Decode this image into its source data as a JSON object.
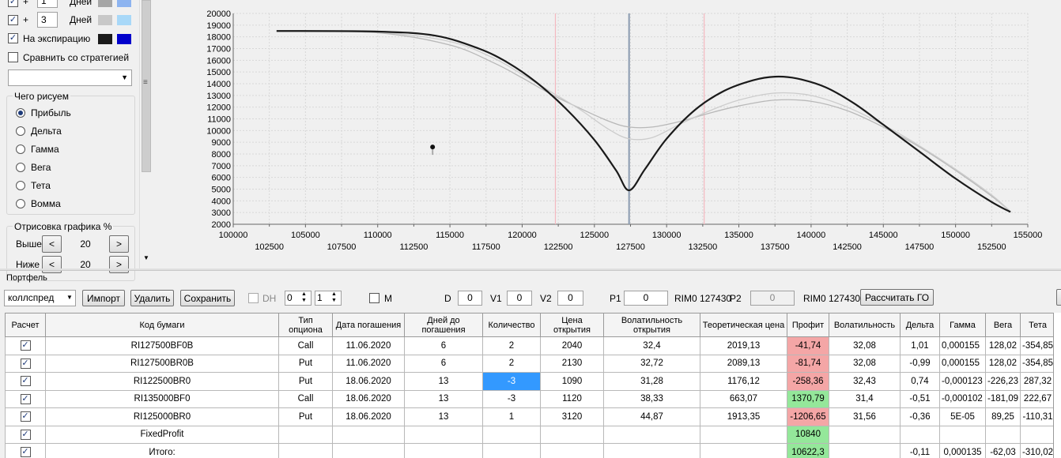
{
  "left_panel": {
    "rows": [
      {
        "sign": "+",
        "days": "1",
        "unit": "Дней",
        "color1": "#a6a6a6",
        "color2": "#8db4f0"
      },
      {
        "sign": "+",
        "days": "3",
        "unit": "Дней",
        "color1": "#c8c8c8",
        "color2": "#a8d8f8"
      }
    ],
    "expiry_label": "На экспирацию",
    "expiry_color1": "#1a1a1a",
    "expiry_color2": "#0000cc",
    "compare_label": "Сравнить со стратегией",
    "draw_group": {
      "title": "Чего рисуем",
      "options": [
        "Прибыль",
        "Дельта",
        "Гамма",
        "Вега",
        "Тета",
        "Вомма"
      ],
      "selected": "Прибыль"
    },
    "render_group": {
      "title": "Отрисовка графика %",
      "above_label": "Выше",
      "above_value": "20",
      "below_label": "Ниже",
      "below_value": "20",
      "dec": "<",
      "inc": ">"
    }
  },
  "chart_data": {
    "type": "line",
    "title": "",
    "xlabel": "",
    "ylabel": "",
    "xlim": [
      100000,
      155000
    ],
    "ylim": [
      2000,
      20000
    ],
    "x_ticks_top": [
      "100000",
      "110000",
      "115000",
      "120000",
      "125000",
      "130000",
      "135000",
      "140000",
      "145000",
      "150000",
      "155000"
    ],
    "x_ticks_upper": [
      100000,
      105000,
      110000,
      115000,
      120000,
      125000,
      130000,
      135000,
      140000,
      145000,
      150000,
      155000
    ],
    "x_ticks_lower": [
      102500,
      107500,
      112500,
      117500,
      122500,
      127500,
      132500,
      137500,
      142500,
      147500,
      152500
    ],
    "y_ticks": [
      2000,
      3000,
      4000,
      5000,
      6000,
      7000,
      8000,
      9000,
      10000,
      11000,
      12000,
      13000,
      14000,
      15000,
      16000,
      17000,
      18000,
      19000,
      20000
    ],
    "grid": true,
    "vlines": [
      {
        "x": 122300,
        "color": "#f4b8c0"
      },
      {
        "x": 127400,
        "color": "#8a9bb0"
      },
      {
        "x": 132600,
        "color": "#f4b8c0"
      }
    ],
    "marker": {
      "x": 113800,
      "y": 8600
    },
    "series": [
      {
        "color": "#b8b8b8",
        "points": [
          [
            103000,
            18500
          ],
          [
            110000,
            18350
          ],
          [
            115000,
            17300
          ],
          [
            118000,
            15800
          ],
          [
            120000,
            14500
          ],
          [
            122000,
            13100
          ],
          [
            124000,
            11900
          ],
          [
            126000,
            10800
          ],
          [
            127400,
            10300
          ],
          [
            129000,
            10300
          ],
          [
            131000,
            10800
          ],
          [
            133000,
            11500
          ],
          [
            135000,
            12100
          ],
          [
            137500,
            12600
          ],
          [
            140000,
            12500
          ],
          [
            142500,
            11700
          ],
          [
            145000,
            10300
          ],
          [
            147500,
            8600
          ],
          [
            150000,
            6600
          ],
          [
            152500,
            4400
          ],
          [
            153800,
            3100
          ]
        ]
      },
      {
        "color": "#cccccc",
        "points": [
          [
            103000,
            18500
          ],
          [
            110000,
            18400
          ],
          [
            115000,
            17600
          ],
          [
            118000,
            16200
          ],
          [
            120000,
            14800
          ],
          [
            122000,
            13300
          ],
          [
            124000,
            11800
          ],
          [
            126000,
            10100
          ],
          [
            127400,
            9300
          ],
          [
            129000,
            9400
          ],
          [
            131000,
            10600
          ],
          [
            133000,
            11700
          ],
          [
            135000,
            12600
          ],
          [
            137500,
            13200
          ],
          [
            140000,
            13000
          ],
          [
            142500,
            12000
          ],
          [
            145000,
            10500
          ],
          [
            147500,
            8700
          ],
          [
            150000,
            6700
          ],
          [
            152500,
            4500
          ],
          [
            153800,
            3100
          ]
        ]
      },
      {
        "color": "#1a1a1a",
        "points": [
          [
            103000,
            18500
          ],
          [
            110000,
            18450
          ],
          [
            114000,
            18100
          ],
          [
            117000,
            17000
          ],
          [
            119000,
            15800
          ],
          [
            121000,
            14100
          ],
          [
            123000,
            11900
          ],
          [
            125000,
            9200
          ],
          [
            126500,
            6600
          ],
          [
            127400,
            4900
          ],
          [
            128500,
            6700
          ],
          [
            130000,
            9300
          ],
          [
            132000,
            11800
          ],
          [
            134000,
            13400
          ],
          [
            136000,
            14300
          ],
          [
            137500,
            14600
          ],
          [
            139000,
            14450
          ],
          [
            141000,
            13700
          ],
          [
            143000,
            12300
          ],
          [
            145000,
            10500
          ],
          [
            147500,
            8200
          ],
          [
            150000,
            5900
          ],
          [
            152500,
            3900
          ],
          [
            153800,
            3050
          ]
        ]
      }
    ]
  },
  "portfolio": {
    "title": "Портфель",
    "strategy": "коллспред",
    "import_btn": "Импорт",
    "delete_btn": "Удалить",
    "save_btn": "Сохранить",
    "dh_label": "DH",
    "spin1": "0",
    "spin2": "1",
    "m_label": "M",
    "d_label": "D",
    "d_value": "0",
    "v1_label": "V1",
    "v1_value": "0",
    "v2_label": "V2",
    "v2_value": "0",
    "p1_label": "P1",
    "p1_value": "0",
    "p1_instrument": "RIM0 127430",
    "p2_label": "P2",
    "p2_value": "0",
    "p2_instrument": "RIM0 127430",
    "go_btn": "Рассчитать ГО"
  },
  "table": {
    "columns": [
      "Расчет",
      "Код бумаги",
      "Тип опциона",
      "Дата погашения",
      "Дней до погашения",
      "Количество",
      "Цена открытия",
      "Волатильность открытия",
      "Теоретическая цена",
      "Профит",
      "Волатильность",
      "Дельта",
      "Гамма",
      "Вега",
      "Тета"
    ],
    "rows": [
      {
        "check": "✓",
        "code": "RI127500BF0B",
        "type": "Call",
        "date": "11.06.2020",
        "days": "6",
        "qty": "2",
        "price": "2040",
        "vol_open": "32,4",
        "theor": "2019,13",
        "profit": "-41,74",
        "vol": "32,08",
        "delta": "1,01",
        "gamma": "0,000155",
        "vega": "128,02",
        "theta": "-354,85"
      },
      {
        "check": "✓",
        "code": "RI127500BR0B",
        "type": "Put",
        "date": "11.06.2020",
        "days": "6",
        "qty": "2",
        "price": "2130",
        "vol_open": "32,72",
        "theor": "2089,13",
        "profit": "-81,74",
        "vol": "32,08",
        "delta": "-0,99",
        "gamma": "0,000155",
        "vega": "128,02",
        "theta": "-354,85"
      },
      {
        "check": "✓",
        "code": "RI122500BR0",
        "type": "Put",
        "date": "18.06.2020",
        "days": "13",
        "qty": "-3",
        "price": "1090",
        "vol_open": "31,28",
        "theor": "1176,12",
        "profit": "-258,36",
        "vol": "32,43",
        "delta": "0,74",
        "gamma": "-0,000123",
        "vega": "-226,23",
        "theta": "287,32"
      },
      {
        "check": "✓",
        "code": "RI135000BF0",
        "type": "Call",
        "date": "18.06.2020",
        "days": "13",
        "qty": "-3",
        "price": "1120",
        "vol_open": "38,33",
        "theor": "663,07",
        "profit": "1370,79",
        "vol": "31,4",
        "delta": "-0,51",
        "gamma": "-0,000102",
        "vega": "-181,09",
        "theta": "222,67"
      },
      {
        "check": "✓",
        "code": "RI125000BR0",
        "type": "Put",
        "date": "18.06.2020",
        "days": "13",
        "qty": "1",
        "price": "3120",
        "vol_open": "44,87",
        "theor": "1913,35",
        "profit": "-1206,65",
        "vol": "31,56",
        "delta": "-0,36",
        "gamma": "5E-05",
        "vega": "89,25",
        "theta": "-110,31"
      },
      {
        "check": "✓",
        "code": "FixedProfit",
        "type": "",
        "date": "",
        "days": "",
        "qty": "",
        "price": "",
        "vol_open": "",
        "theor": "",
        "profit": "10840",
        "vol": "",
        "delta": "",
        "gamma": "",
        "vega": "",
        "theta": ""
      },
      {
        "check": "✓",
        "code": "Итого:",
        "type": "",
        "date": "",
        "days": "",
        "qty": "",
        "price": "",
        "vol_open": "",
        "theor": "",
        "profit": "10622,3",
        "vol": "",
        "delta": "-0,11",
        "gamma": "0,000135",
        "vega": "-62,03",
        "theta": "-310,02"
      }
    ],
    "row_classes": [
      "red",
      "red",
      "red",
      "green",
      "red",
      "green",
      "green"
    ]
  }
}
